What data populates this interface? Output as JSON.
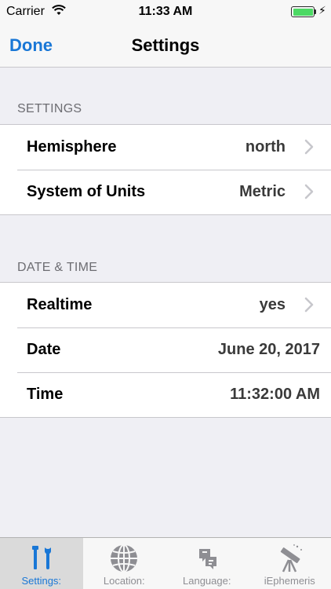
{
  "status_bar": {
    "carrier": "Carrier",
    "time": "11:33 AM",
    "battery_level": 1.0,
    "battery_color": "#4cd964"
  },
  "nav": {
    "done_label": "Done",
    "title": "Settings"
  },
  "sections": {
    "settings": {
      "header": "SETTINGS",
      "rows": [
        {
          "label": "Hemisphere",
          "value": "north",
          "chevron": true
        },
        {
          "label": "System of Units",
          "value": "Metric",
          "chevron": true
        }
      ]
    },
    "date_time": {
      "header": "DATE & TIME",
      "rows": [
        {
          "label": "Realtime",
          "value": "yes",
          "chevron": true
        },
        {
          "label": "Date",
          "value": "June 20, 2017",
          "chevron": false
        },
        {
          "label": "Time",
          "value": "11:32:00 AM",
          "chevron": false
        }
      ]
    }
  },
  "tab_bar": {
    "active_index": 0,
    "tabs": [
      {
        "label": "Settings:",
        "icon": "tools-icon"
      },
      {
        "label": "Location:",
        "icon": "globe-icon"
      },
      {
        "label": "Language:",
        "icon": "language-icon"
      },
      {
        "label": "iEphemeris",
        "icon": "telescope-icon"
      }
    ]
  },
  "colors": {
    "accent": "#1977d6",
    "background": "#efeff4",
    "inactive_tab": "#8e8e93"
  }
}
